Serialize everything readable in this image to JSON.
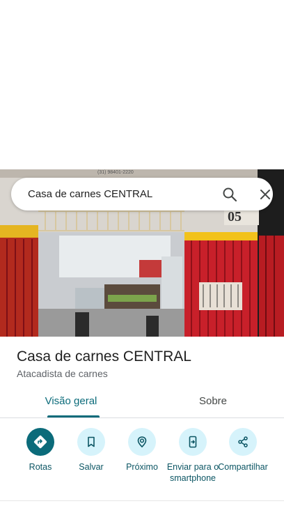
{
  "search": {
    "query": "Casa de carnes CENTRAL"
  },
  "place": {
    "name": "Casa de carnes CENTRAL",
    "category": "Atacadista de carnes",
    "photo_sign_text": "(31) 98401-2220",
    "photo_number": "05"
  },
  "tabs": [
    {
      "label": "Visão geral",
      "active": true
    },
    {
      "label": "Sobre",
      "active": false
    }
  ],
  "actions": [
    {
      "label": "Rotas",
      "icon": "directions-icon"
    },
    {
      "label": "Salvar",
      "icon": "bookmark-icon"
    },
    {
      "label": "Próximo",
      "icon": "nearby-icon"
    },
    {
      "label": "Enviar para o smartphone",
      "icon": "send-to-phone-icon"
    },
    {
      "label": "Compartilhar",
      "icon": "share-icon"
    }
  ],
  "colors": {
    "accent": "#0b6b7a",
    "action_bg": "#d6f3fb",
    "gate_red": "#c8202a",
    "wall_yellow": "#f2c21b"
  }
}
